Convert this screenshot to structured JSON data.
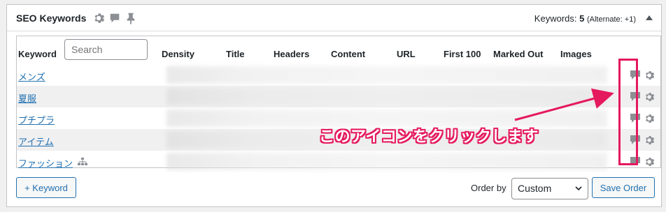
{
  "panel": {
    "title": "SEO Keywords",
    "icons": [
      "gear-icon",
      "comment-icon",
      "pin-icon"
    ],
    "keywords_label": "Keywords:",
    "keywords_count": "5",
    "alternate": "(Alternate: +1)"
  },
  "table": {
    "columns": [
      "Keyword",
      "Density",
      "Title",
      "Headers",
      "Content",
      "URL",
      "First 100",
      "Marked Out",
      "Images"
    ],
    "search_placeholder": "Search",
    "rows": [
      {
        "keyword": "メンズ",
        "has_tree_icon": false
      },
      {
        "keyword": "夏服",
        "has_tree_icon": false
      },
      {
        "keyword": "プチプラ",
        "has_tree_icon": false
      },
      {
        "keyword": "アイテム",
        "has_tree_icon": false
      },
      {
        "keyword": "ファッション",
        "has_tree_icon": true
      }
    ]
  },
  "annotation": {
    "text": "このアイコンをクリックします",
    "color": "#e5195e"
  },
  "footer": {
    "add_keyword": "+ Keyword",
    "order_by_label": "Order by",
    "order_by_value": "Custom",
    "save_order": "Save Order"
  },
  "colors": {
    "link": "#2271b1",
    "highlight": "#e5195e",
    "icon": "#8c8f94"
  }
}
